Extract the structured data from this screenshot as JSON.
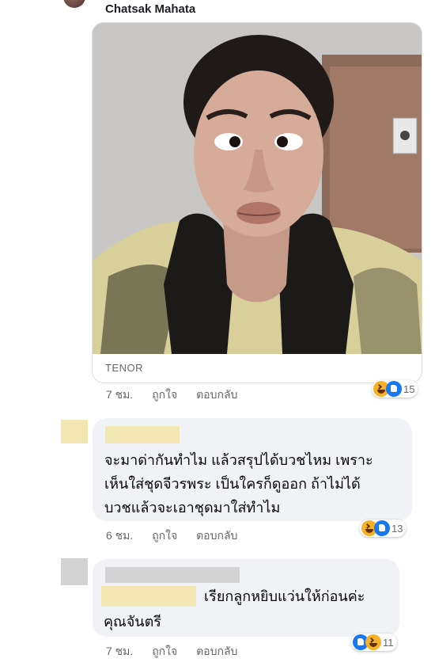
{
  "comment1": {
    "author": "Chatsak Mahata",
    "gif_source": "TENOR",
    "time": "7 ชม.",
    "like_label": "ถูกใจ",
    "reply_label": "ตอบกลับ",
    "reaction_count": "15",
    "reaction_icons": [
      "haha-icon",
      "like-icon"
    ]
  },
  "comment2": {
    "lines": [
      "จะมาด่ากันทำไม แล้วสรุปได้บวชไหม เพราะ",
      "เห็นใส่ชุดจีวรพระ เป็นใครก็ดูออก ถ้าไม่ได้",
      "บวชแล้วจะเอาชุดมาใส่ทำไม"
    ],
    "time": "6 ชม.",
    "like_label": "ถูกใจ",
    "reply_label": "ตอบกลับ",
    "reaction_count": "13",
    "reaction_icons": [
      "haha-icon",
      "like-icon"
    ]
  },
  "comment3": {
    "line1": "เรียกลูกหยิบแว่นให้ก่อนค่ะ",
    "line2": "คุณจันตรี",
    "time": "7 ชม.",
    "like_label": "ถูกใจ",
    "reply_label": "ตอบกลับ",
    "reaction_count": "11",
    "reaction_icons": [
      "like-icon",
      "haha-icon"
    ]
  },
  "colors": {
    "bubble": "#f0f2f5",
    "meta_text": "#65676b",
    "like_blue": "#1877f2",
    "haha_yellow": "#f7b125",
    "redaction_yellow": "#f2e6b3",
    "redaction_gray": "#d3d3d3"
  }
}
